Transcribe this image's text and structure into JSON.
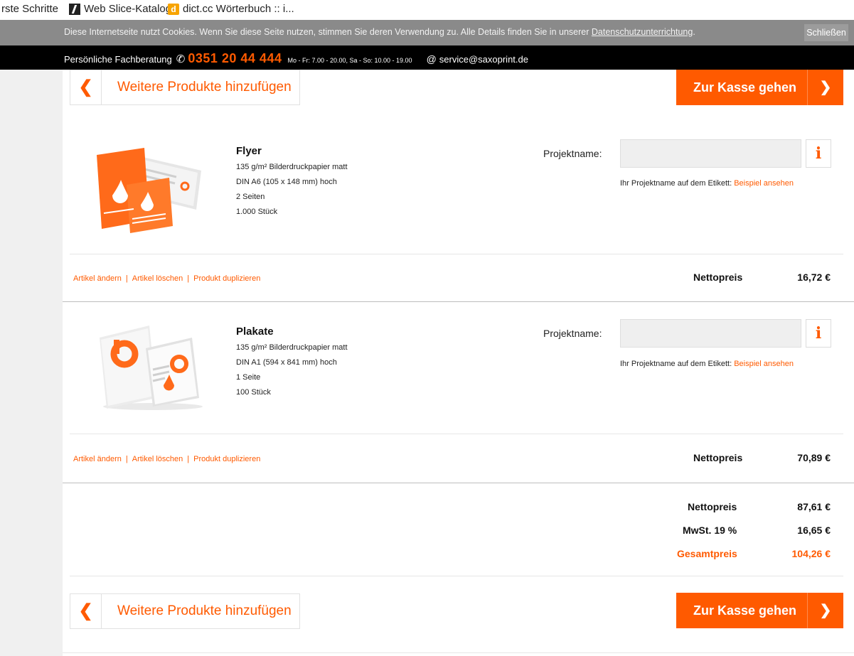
{
  "bookmarks": {
    "item1": "rste Schritte",
    "item2": "Web Slice-Katalog",
    "item3_icon": "d",
    "item3": "dict.cc Wörterbuch :: i..."
  },
  "cookie": {
    "text": "Diese Internetseite nutzt Cookies. Wenn Sie diese Seite nutzen, stimmen Sie deren Verwendung zu. Alle Details finden Sie in unserer",
    "link": "Datenschutzunterrichtung",
    "close": "Schließen"
  },
  "contact": {
    "label": "Persönliche Fachberatung",
    "phone": "0351 20 44 444",
    "hours": "Mo - Fr: 7.00 - 20.00, Sa - So: 10.00 - 19.00",
    "email": "service@saxoprint.de"
  },
  "buttons": {
    "back": "Weitere Produkte hinzufügen",
    "checkout": "Zur Kasse gehen",
    "back_chevron": "❮",
    "checkout_chevron": "❯"
  },
  "products": [
    {
      "title": "Flyer",
      "details": [
        "135 g/m² Bilderdruckpapier matt",
        "DIN A6 (105 x 148 mm) hoch",
        "2 Seiten",
        "1.000 Stück"
      ],
      "project_label": "Projektname:",
      "project_value": "",
      "hint": "Ihr Projektname auf dem Etikett:",
      "hint_link": "Beispiel ansehen",
      "actions": [
        "Artikel ändern",
        "Artikel löschen",
        "Produkt duplizieren"
      ],
      "price_label": "Nettopreis",
      "price": "16,72 €",
      "info": "i"
    },
    {
      "title": "Plakate",
      "details": [
        "135 g/m² Bilderdruckpapier matt",
        "DIN A1 (594 x 841 mm) hoch",
        "1 Seite",
        "100 Stück"
      ],
      "project_label": "Projektname:",
      "project_value": "",
      "hint": "Ihr Projektname auf dem Etikett:",
      "hint_link": "Beispiel ansehen",
      "actions": [
        "Artikel ändern",
        "Artikel löschen",
        "Produkt duplizieren"
      ],
      "price_label": "Nettopreis",
      "price": "70,89 €",
      "info": "i"
    }
  ],
  "totals": {
    "net_label": "Nettopreis",
    "net": "87,61 €",
    "vat_label": "MwSt. 19 %",
    "vat": "16,65 €",
    "gross_label": "Gesamtpreis",
    "gross": "104,26 €"
  },
  "colors": {
    "accent": "#ff5a00",
    "cookie_bar": "#8a8a8a",
    "contact_bar": "#000000"
  }
}
